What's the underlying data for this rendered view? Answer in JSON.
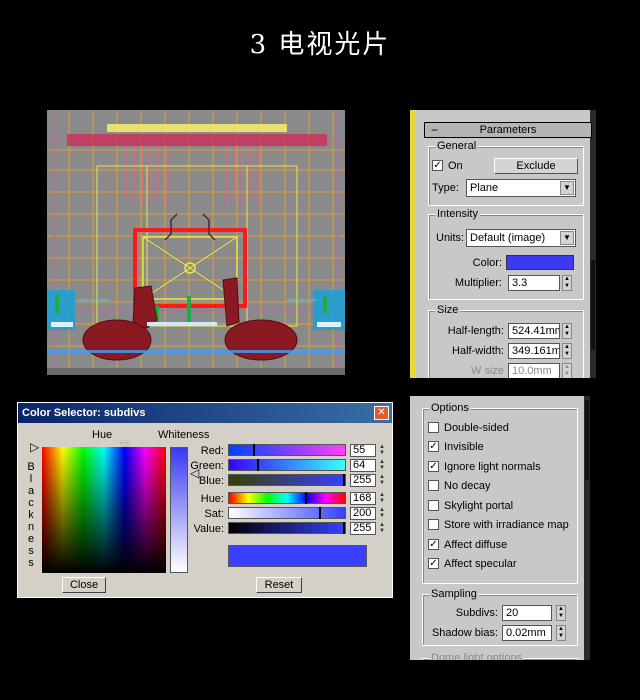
{
  "page_title": "3 电视光片",
  "parameters": {
    "rollout_title": "Parameters",
    "general": {
      "title": "General",
      "on_label": "On",
      "on_checked": true,
      "exclude_label": "Exclude",
      "type_label": "Type:",
      "type_value": "Plane"
    },
    "intensity": {
      "title": "Intensity",
      "units_label": "Units:",
      "units_value": "Default (image)",
      "color_label": "Color:",
      "color_value": "#3a3af0",
      "multiplier_label": "Multiplier:",
      "multiplier_value": "3.3"
    },
    "size": {
      "title": "Size",
      "half_length_label": "Half-length:",
      "half_length_value": "524.41mm",
      "half_width_label": "Half-width:",
      "half_width_value": "349.161m",
      "w_size_label": "W size",
      "w_size_value": "10.0mm"
    }
  },
  "options": {
    "title": "Options",
    "items": [
      {
        "label": "Double-sided",
        "checked": false
      },
      {
        "label": "Invisible",
        "checked": true
      },
      {
        "label": "Ignore light normals",
        "checked": true
      },
      {
        "label": "No decay",
        "checked": false
      },
      {
        "label": "Skylight portal",
        "checked": false
      },
      {
        "label": "Store with irradiance map",
        "checked": false
      },
      {
        "label": "Affect diffuse",
        "checked": true
      },
      {
        "label": "Affect specular",
        "checked": true
      }
    ]
  },
  "sampling": {
    "title": "Sampling",
    "subdivs_label": "Subdivs:",
    "subdivs_value": "20",
    "shadow_bias_label": "Shadow bias:",
    "shadow_bias_value": "0.02mm",
    "next_rollout": "Dome light options"
  },
  "color_selector": {
    "title": "Color Selector: subdivs",
    "hue_label": "Hue",
    "whiteness_label": "Whiteness",
    "blackness_label": "Blackness",
    "red_label": "Red:",
    "red_value": "55",
    "green_label": "Green:",
    "green_value": "64",
    "blue_label": "Blue:",
    "blue_value": "255",
    "hue_field_label": "Hue:",
    "hue_value": "168",
    "sat_label": "Sat:",
    "sat_value": "200",
    "value_label": "Value:",
    "value_value": "255",
    "current_color": "#3740ff",
    "close_label": "Close",
    "reset_label": "Reset"
  }
}
